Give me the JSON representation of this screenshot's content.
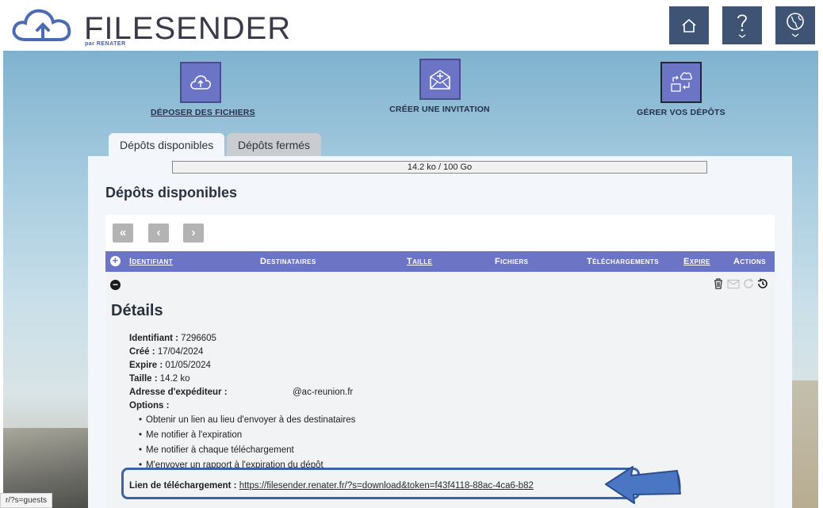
{
  "header": {
    "logo_main": "FILESENDER",
    "logo_sub": "par RENATER",
    "buttons": [
      {
        "icon": "home-icon"
      },
      {
        "icon": "help-icon"
      },
      {
        "icon": "language-globe-icon"
      }
    ]
  },
  "nav": {
    "upload": "DÉPOSER DES FICHIERS",
    "invite": "CRÉER UNE INVITATION",
    "manage": "GÉRER VOS DÉPÔTS"
  },
  "tabs": {
    "available": "Dépôts disponibles",
    "closed": "Dépôts fermés"
  },
  "quota": "14.2 ko / 100 Go",
  "panel_title": "Dépôts disponibles",
  "pager": {
    "first": "«",
    "prev": "‹",
    "next": "›"
  },
  "table": {
    "columns": {
      "id": "Identifiant",
      "recipients": "Destinataires",
      "size": "Taille",
      "files": "Fichiers",
      "downloads": "Téléchargements",
      "expires": "Expire",
      "actions": "Actions"
    }
  },
  "details": {
    "title": "Détails",
    "id_label": "Identifiant :",
    "id_value": "7296605",
    "created_label": "Créé :",
    "created_value": "17/04/2024",
    "expires_label": "Expire :",
    "expires_value": "01/05/2024",
    "size_label": "Taille :",
    "size_value": "14.2 ko",
    "sender_label": "Adresse d'expéditeur :",
    "sender_value": "@ac-reunion.fr",
    "options_label": "Options :",
    "options": [
      "Obtenir un lien au lieu d'envoyer à des destinataires",
      "Me notifier à l'expiration",
      "Me notifier à chaque téléchargement",
      "M'envoyer un rapport à l'expiration du dépôt"
    ],
    "download_label": "Lien de téléchargement :",
    "download_link": "https://filesender.renater.fr/?s=download&token=f43f4118-88ac-4ca6-b82"
  },
  "status_url": "r/?s=guests",
  "colors": {
    "header_button": "#3f5474",
    "accent": "#6c74c6",
    "highlight": "#3b63a6"
  }
}
